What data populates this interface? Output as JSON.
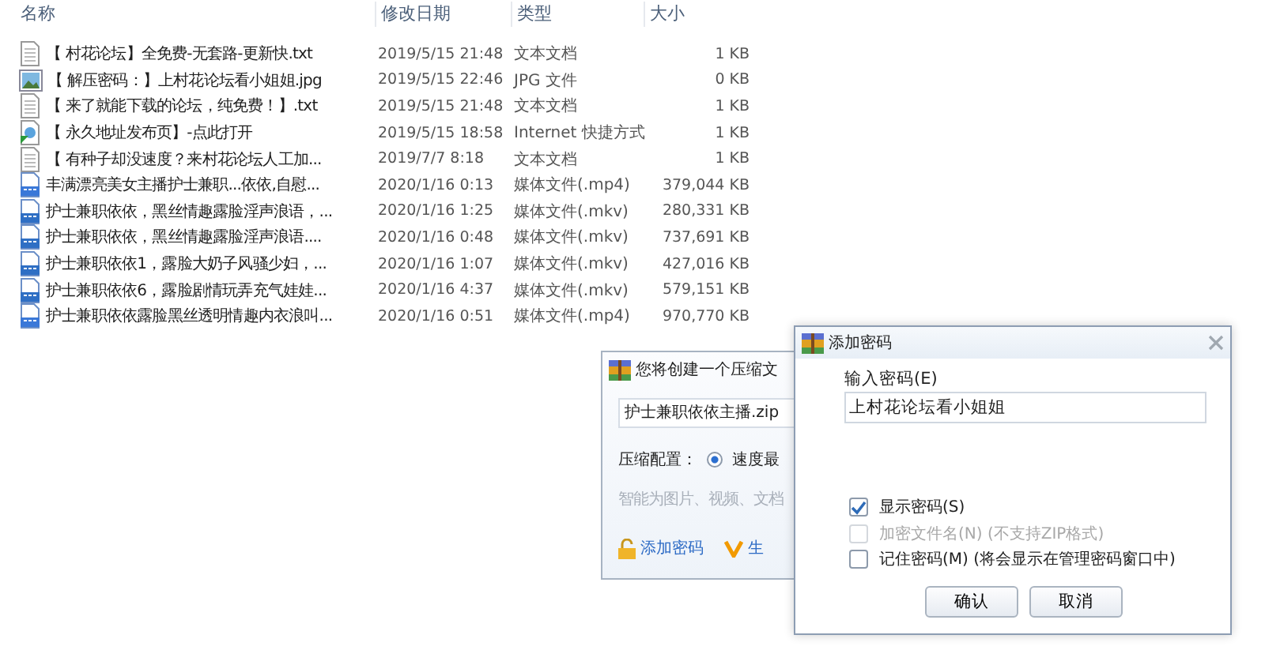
{
  "columns": [
    "名称",
    "修改日期",
    "类型",
    "大小"
  ],
  "files": [
    {
      "kind": "text",
      "name": "【 村花论坛】全免费-无套路-更新快.txt",
      "date": "2019/5/15 21:48",
      "type": "文本文档",
      "size": "1 KB"
    },
    {
      "kind": "image",
      "name": "【 解压密码：】上村花论坛看小姐姐.jpg",
      "date": "2019/5/15 22:46",
      "type": "JPG 文件",
      "size": "0 KB"
    },
    {
      "kind": "text",
      "name": "【 来了就能下载的论坛，纯免费！】.txt",
      "date": "2019/5/15 21:48",
      "type": "文本文档",
      "size": "1 KB"
    },
    {
      "kind": "shortcut",
      "name": "【 永久地址发布页】-点此打开",
      "date": "2019/5/15 18:58",
      "type": "Internet 快捷方式",
      "size": "1 KB"
    },
    {
      "kind": "text",
      "name": "【 有种子却没速度？来村花论坛人工加...",
      "date": "2019/7/7 8:18",
      "type": "文本文档",
      "size": "1 KB"
    },
    {
      "kind": "mp4",
      "name": "丰满漂亮美女主播护士兼职...依依,自慰...",
      "date": "2020/1/16 0:13",
      "type": "媒体文件(.mp4)",
      "size": "379,044 KB"
    },
    {
      "kind": "mkv",
      "name": "护士兼职依依，黑丝情趣露脸淫声浪语，...",
      "date": "2020/1/16 1:25",
      "type": "媒体文件(.mkv)",
      "size": "280,331 KB"
    },
    {
      "kind": "mkv",
      "name": "护士兼职依依，黑丝情趣露脸淫声浪语....",
      "date": "2020/1/16 0:48",
      "type": "媒体文件(.mkv)",
      "size": "737,691 KB"
    },
    {
      "kind": "mkv",
      "name": "护士兼职依依1，露脸大奶子风骚少妇，...",
      "date": "2020/1/16 1:07",
      "type": "媒体文件(.mkv)",
      "size": "427,016 KB"
    },
    {
      "kind": "mkv",
      "name": "护士兼职依依6，露脸剧情玩弄充气娃娃...",
      "date": "2020/1/16 4:37",
      "type": "媒体文件(.mkv)",
      "size": "579,151 KB"
    },
    {
      "kind": "mp4",
      "name": "护士兼职依依露脸黑丝透明情趣内衣浪叫...",
      "date": "2020/1/16 0:51",
      "type": "媒体文件(.mp4)",
      "size": "970,770 KB"
    }
  ],
  "archive_dialog": {
    "title": "您将创建一个压缩文",
    "filename": "护士兼职依依主播.zip",
    "profile_label": "压缩配置：",
    "profile_option": {
      "label": "速度最",
      "selected": true
    },
    "hint": "智能为图片、视频、文档",
    "links": [
      "添加密码",
      "生"
    ]
  },
  "password_dialog": {
    "title": "添加密码",
    "field_label": "输入密码(E)",
    "password": "上村花论坛看小姐姐",
    "options": [
      {
        "label": "显示密码(S)",
        "checked": true,
        "disabled": false
      },
      {
        "label": "加密文件名(N) (不支持ZIP格式)",
        "checked": false,
        "disabled": true
      },
      {
        "label": "记住密码(M) (将会显示在管理密码窗口中)",
        "checked": false,
        "disabled": false
      }
    ],
    "buttons": [
      "确认",
      "取消"
    ]
  }
}
